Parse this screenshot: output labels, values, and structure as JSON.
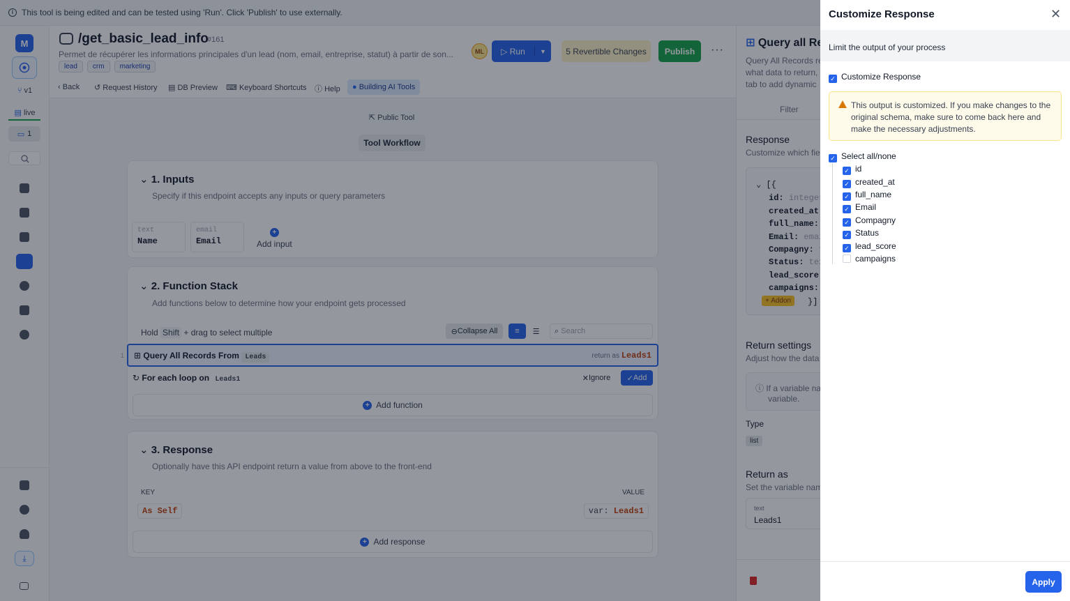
{
  "banner": {
    "text": "This tool is being edited and can be tested using 'Run'. Click 'Publish' to use externally."
  },
  "rail": {
    "logo": "M",
    "version": "v1",
    "live": "live",
    "comments": "1"
  },
  "header": {
    "title": "/get_basic_lead_info",
    "id": "#161",
    "description": "Permet de récupérer les informations principales d'un lead (nom, email, entreprise, statut) à partir de son...",
    "tags": [
      "lead",
      "crm",
      "marketing"
    ],
    "avatar": "ML",
    "run": "Run",
    "revertible": "5 Revertible Changes",
    "publish": "Publish",
    "more": "···"
  },
  "nav": {
    "back": "Back",
    "history": "Request History",
    "db": "DB Preview",
    "shortcuts": "Keyboard Shortcuts",
    "help": "Help",
    "ai": "Building AI Tools"
  },
  "canvas": {
    "public_tool": "Public Tool",
    "workflow": "Tool Workflow",
    "inputs": {
      "title": "1. Inputs",
      "subtitle": "Specify if this endpoint accepts any inputs or query parameters",
      "items": [
        {
          "type": "text",
          "name": "Name"
        },
        {
          "type": "email",
          "name": "Email"
        }
      ],
      "add": "Add input"
    },
    "stack": {
      "title": "2. Function Stack",
      "subtitle": "Add functions below to determine how your endpoint gets processed",
      "hint_a": "Hold",
      "hint_key": "Shift",
      "hint_b": "+ drag to select multiple",
      "collapse": "Collapse All",
      "search_placeholder": "Search",
      "row1_num": "1",
      "row1_title": "Query All Records From",
      "row1_table": "Leads",
      "row1_return_label": "return as",
      "row1_return": "Leads1",
      "row2_title": "For each loop on",
      "row2_var": "Leads1",
      "ignore": "Ignore",
      "add": "Add",
      "add_function": "Add function"
    },
    "response": {
      "title": "3. Response",
      "subtitle": "Optionally have this API endpoint return a value from above to the front-end",
      "key_header": "KEY",
      "value_header": "VALUE",
      "key": "As Self",
      "value_prefix": "var:",
      "value": "Leads1",
      "add": "Add response"
    }
  },
  "right_panel": {
    "title": "Query all Re",
    "desc1": "Query All Records re",
    "desc2": "what data to return,",
    "desc3": "tab to add dynamic",
    "filter_tab": "Filter",
    "response_title": "Response",
    "response_sub": "Customize which fie",
    "code": {
      "open": "[{",
      "close": "}]",
      "fields": [
        {
          "k": "id:",
          "v": "integer"
        },
        {
          "k": "created_at:",
          "v": ""
        },
        {
          "k": "full_name:",
          "v": ""
        },
        {
          "k": "Email:",
          "v": "emai"
        },
        {
          "k": "Compagny:",
          "v": "t"
        },
        {
          "k": "Status:",
          "v": "tex"
        },
        {
          "k": "lead_score:",
          "v": ""
        },
        {
          "k": "campaigns:",
          "v": ""
        }
      ],
      "addon": "Addon"
    },
    "return_settings": "Return settings",
    "return_settings_sub": "Adjust how the data",
    "info_line1": "If a variable na",
    "info_line2": "variable.",
    "type_label": "Type",
    "type_value": "list",
    "return_as": "Return as",
    "return_as_sub": "Set the variable nam",
    "var_type": "text",
    "var_name": "Leads1"
  },
  "drawer": {
    "title": "Customize Response",
    "subtitle": "Limit the output of your process",
    "customize_label": "Customize Response",
    "warning": "This output is customized. If you make changes to the original schema, make sure to come back here and make the necessary adjustments.",
    "select_all": "Select all/none",
    "fields": [
      {
        "name": "id",
        "checked": true
      },
      {
        "name": "created_at",
        "checked": true
      },
      {
        "name": "full_name",
        "checked": true
      },
      {
        "name": "Email",
        "checked": true
      },
      {
        "name": "Compagny",
        "checked": true
      },
      {
        "name": "Status",
        "checked": true
      },
      {
        "name": "lead_score",
        "checked": true
      },
      {
        "name": "campaigns",
        "checked": false
      }
    ],
    "apply": "Apply"
  },
  "colors": {
    "accent": "#2563eb",
    "publish": "#16a34a",
    "warning_bg": "#fffbeb"
  }
}
